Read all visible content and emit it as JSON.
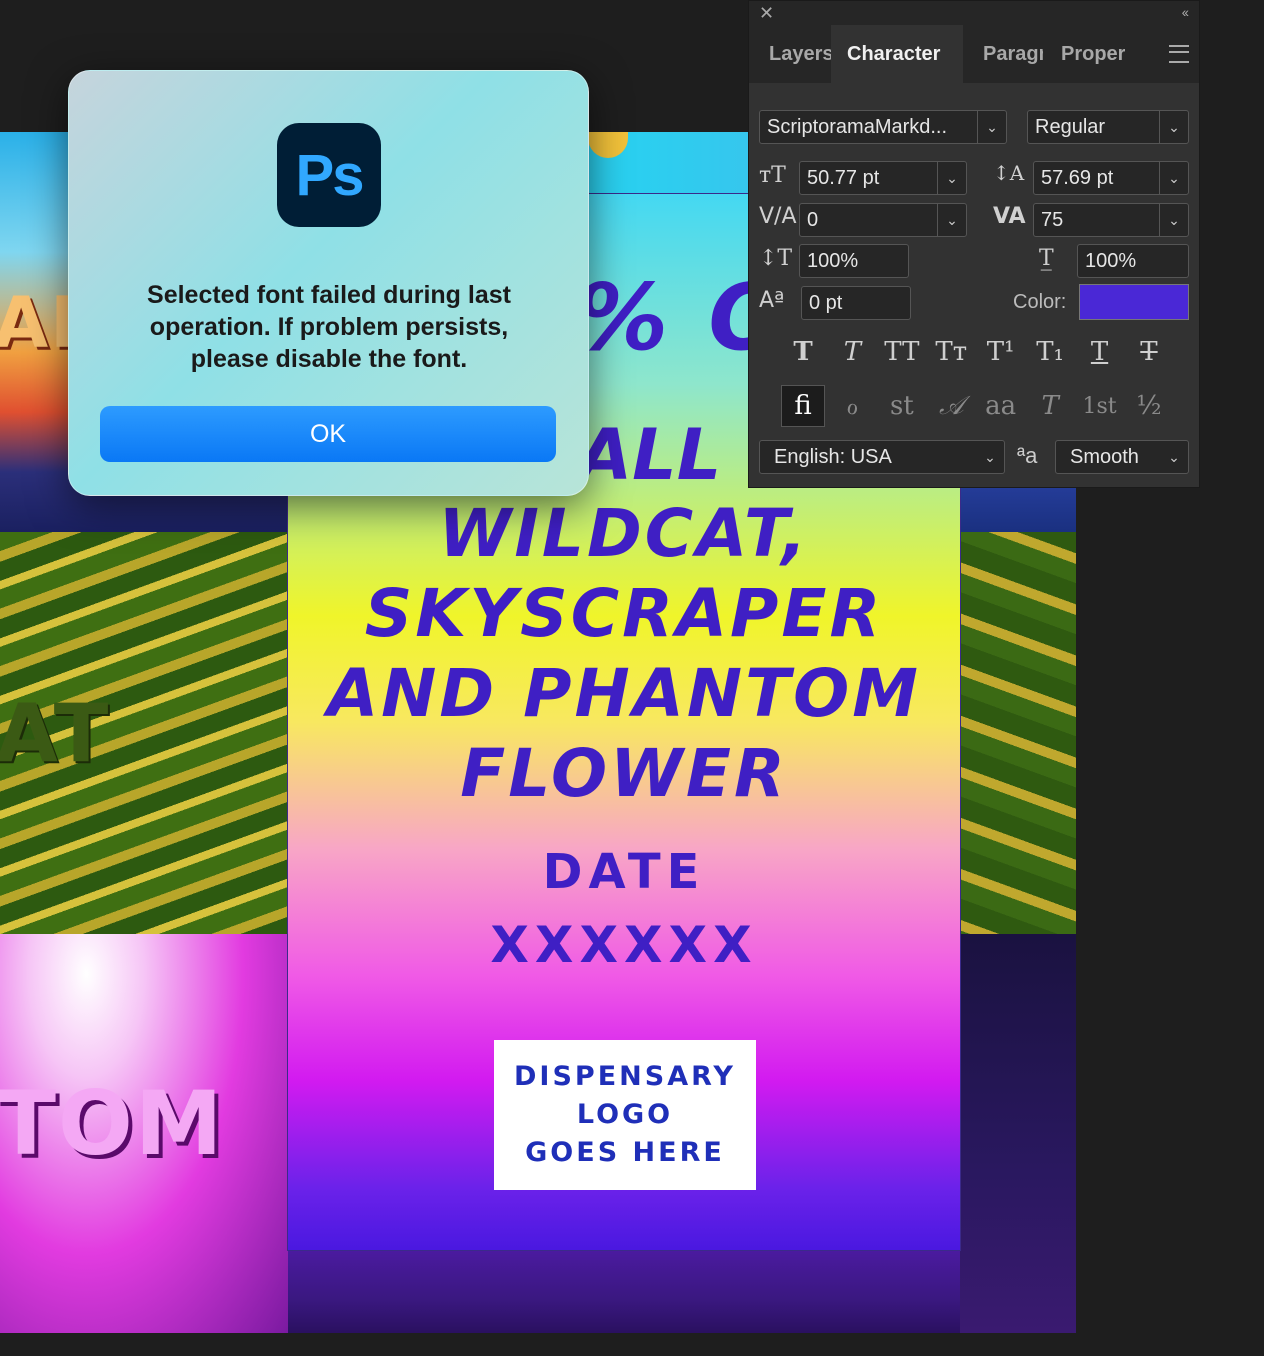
{
  "background": {
    "words": [
      "AP",
      "AT",
      "TOM"
    ]
  },
  "poster": {
    "headline_partial": "% OF",
    "line_all": "ALL",
    "body_lines": "WILDCAT,\nSKYSCRAPER\nAND PHANTOM\nFLOWER",
    "date_label": "DATE",
    "date_value": "XXXXXX",
    "logo_placeholder": "DISPENSARY\nLOGO\nGOES HERE",
    "text_color": "#3f1fc4"
  },
  "dialog": {
    "app_icon_label": "Ps",
    "message": "Selected font failed during last operation. If problem persists, please disable the font.",
    "ok_label": "OK",
    "button_color": "#0a78f5"
  },
  "character_panel": {
    "close_glyph": "✕",
    "collapse_glyph": "‹‹",
    "tabs": [
      {
        "label": "Layers",
        "active": false
      },
      {
        "label": "Character",
        "active": true
      },
      {
        "label": "Paragraph",
        "active": false
      },
      {
        "label": "Properties",
        "active": false
      }
    ],
    "font_family": "ScriptoramaMarkd...",
    "font_style": "Regular",
    "font_size": "50.77 pt",
    "leading": "57.69 pt",
    "kerning": "0",
    "tracking": "75",
    "vertical_scale": "100%",
    "horizontal_scale": "100%",
    "baseline_shift": "0 pt",
    "color_label": "Color:",
    "color_value": "#4a28d6",
    "style_buttons": [
      "T",
      "T",
      "TT",
      "Tт",
      "T¹",
      "T₁",
      "T",
      "T"
    ],
    "opentype_buttons": [
      "ﬁ",
      "ℴ",
      "st",
      "𝒜",
      "aa",
      "T",
      "1st",
      "½"
    ],
    "language": "English: USA",
    "antialias": "Smooth",
    "icons": {
      "font_size": "font-size-icon",
      "leading": "leading-icon",
      "kerning": "kerning-icon",
      "tracking": "tracking-icon",
      "vertical_scale": "vertical-scale-icon",
      "horizontal_scale": "horizontal-scale-icon",
      "baseline": "baseline-shift-icon",
      "antialias": "antialias-icon"
    }
  }
}
